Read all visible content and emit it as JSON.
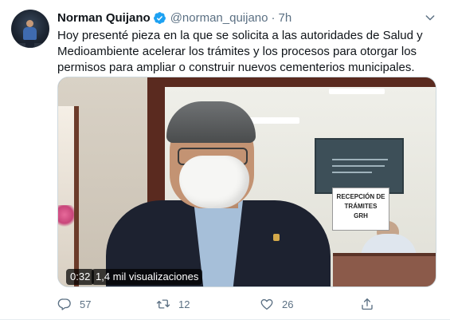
{
  "tweet": {
    "author_name": "Norman Quijano",
    "handle": "@norman_quijano",
    "separator": "·",
    "time": "7h",
    "text": "Hoy presenté pieza en la que se solicita a las autoridades de Salud y Medioambiente acelerar los trámites y los procesos para otorgar los permisos para ampliar o construir nuevos cementerios municipales.",
    "icons": {
      "verified": "verified-badge-icon",
      "more": "chevron-down-icon",
      "reply": "reply-icon",
      "retweet": "retweet-icon",
      "like": "heart-icon",
      "share": "share-icon"
    },
    "colors": {
      "verified": "#1da1f2",
      "secondary_text": "#5b7083"
    }
  },
  "media": {
    "duration": "0:32",
    "views": "1,4 mil visualizaciones",
    "sign_text": [
      "RECEPCIÓN DE",
      "TRÁMITES",
      "GRH"
    ]
  },
  "actions": {
    "replies": "57",
    "retweets": "12",
    "likes": "26"
  }
}
